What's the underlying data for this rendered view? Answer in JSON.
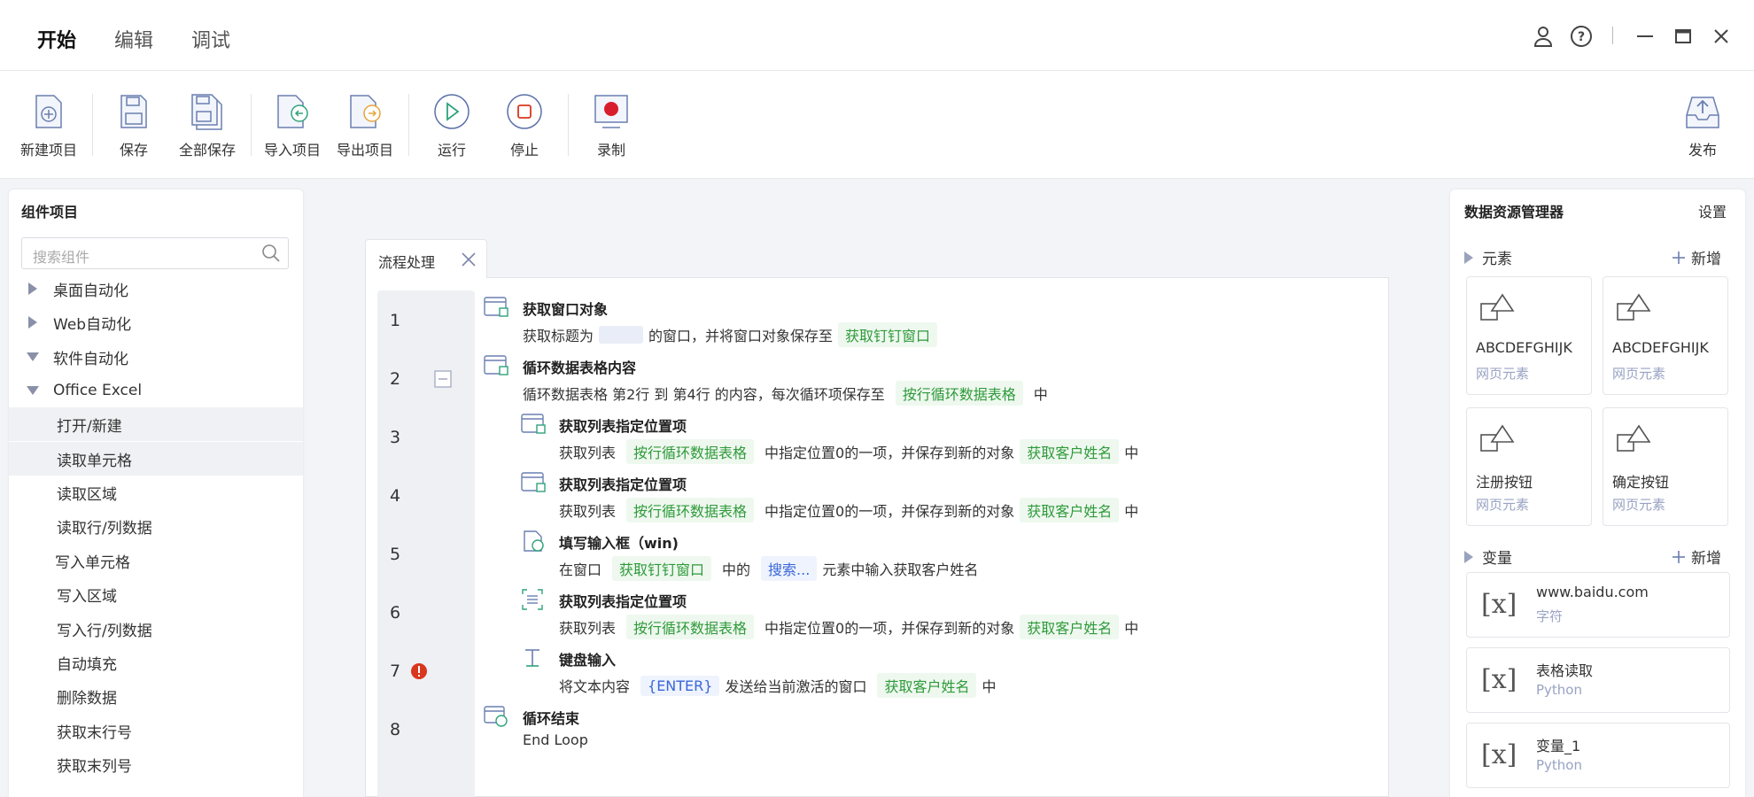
{
  "header": {
    "tabs": [
      {
        "label": "开始",
        "active": true
      },
      {
        "label": "编辑",
        "active": false
      },
      {
        "label": "调试",
        "active": false
      }
    ]
  },
  "toolbar": {
    "new_project": "新建项目",
    "save": "保存",
    "save_all": "全部保存",
    "import_project": "导入项目",
    "export_project": "导出项目",
    "run": "运行",
    "stop": "停止",
    "record": "录制",
    "publish": "发布"
  },
  "left_panel": {
    "title": "组件项目",
    "search_placeholder": "搜索组件",
    "tree": [
      {
        "label": "桌面自动化",
        "type": "collapsed"
      },
      {
        "label": "Web自动化",
        "type": "collapsed"
      },
      {
        "label": "软件自动化",
        "type": "expanded"
      },
      {
        "label": "Office Excel",
        "type": "expanded"
      },
      {
        "label": "打开/新建",
        "type": "leaf",
        "selected": true
      },
      {
        "label": "读取单元格",
        "type": "leaf",
        "selected": true
      },
      {
        "label": "读取区域",
        "type": "leaf"
      },
      {
        "label": "读取行/列数据",
        "type": "leaf"
      },
      {
        "label": "写入单元格",
        "type": "leaf"
      },
      {
        "label": "写入区域",
        "type": "leaf"
      },
      {
        "label": "写入行/列数据",
        "type": "leaf"
      },
      {
        "label": "自动填充",
        "type": "leaf"
      },
      {
        "label": "删除数据",
        "type": "leaf"
      },
      {
        "label": "获取末行号",
        "type": "leaf"
      },
      {
        "label": "获取末列号",
        "type": "leaf"
      }
    ]
  },
  "editor": {
    "tab_label": "流程处理",
    "line_numbers": [
      "1",
      "2",
      "3",
      "4",
      "5",
      "6",
      "7",
      "8"
    ],
    "steps": {
      "s1": {
        "title": "获取窗口对象",
        "d1": "获取标题为",
        "d2": "的窗口，并将窗口对象保存至",
        "tag": "获取钉钉窗口"
      },
      "s2": {
        "title": "循环数据表格内容",
        "d1": "循环数据表格 第2行 到 第4行 的内容，每次循环项保存至",
        "tag": "按行循环数据表格",
        "d2": "中"
      },
      "s3": {
        "title": "获取列表指定位置项",
        "d1": "获取列表",
        "tag1": "按行循环数据表格",
        "d2": "中指定位置0的一项，并保存到新的对象",
        "tag2": "获取客户姓名",
        "d3": "中"
      },
      "s4": {
        "title": "获取列表指定位置项",
        "d1": "获取列表",
        "tag1": "按行循环数据表格",
        "d2": "中指定位置0的一项，并保存到新的对象",
        "tag2": "获取客户姓名",
        "d3": "中"
      },
      "s5": {
        "title": "填写输入框（win)",
        "d1": "在窗口",
        "tag1": "获取钉钉窗口",
        "d2": "中的",
        "tag2": "搜索...",
        "d3": "元素中输入获取客户姓名"
      },
      "s6": {
        "title": "获取列表指定位置项",
        "d1": "获取列表",
        "tag1": "按行循环数据表格",
        "d2": "中指定位置0的一项，并保存到新的对象",
        "tag2": "获取客户姓名",
        "d3": "中"
      },
      "s7": {
        "title": "键盘输入",
        "d1": "将文本内容",
        "tag1": "{ENTER}",
        "d2": "发送给当前激活的窗口",
        "tag2": "获取客户姓名",
        "d3": "中"
      },
      "s8": {
        "title": "循环结束",
        "d1": "End Loop"
      }
    }
  },
  "right_panel": {
    "title": "数据资源管理器",
    "settings": "设置",
    "elements_header": "元素",
    "add_label": "新增",
    "element_cards": [
      {
        "name": "ABCDEFGHIJK",
        "type": "网页元素"
      },
      {
        "name": "ABCDEFGHIJK",
        "type": "网页元素"
      },
      {
        "name": "注册按钮",
        "type": "网页元素"
      },
      {
        "name": "确定按钮",
        "type": "网页元素"
      }
    ],
    "variables_header": "变量",
    "variables": [
      {
        "name": "www.baidu.com",
        "type": "字符"
      },
      {
        "name": "表格读取",
        "type": "Python"
      },
      {
        "name": "变量_1",
        "type": "Python"
      }
    ],
    "icon_glyph": "[x]"
  },
  "colors": {
    "accent_green": "#2f9a3a",
    "accent_blue": "#3a66d8",
    "error_red": "#d9361e",
    "record_red": "#d81e2c"
  }
}
